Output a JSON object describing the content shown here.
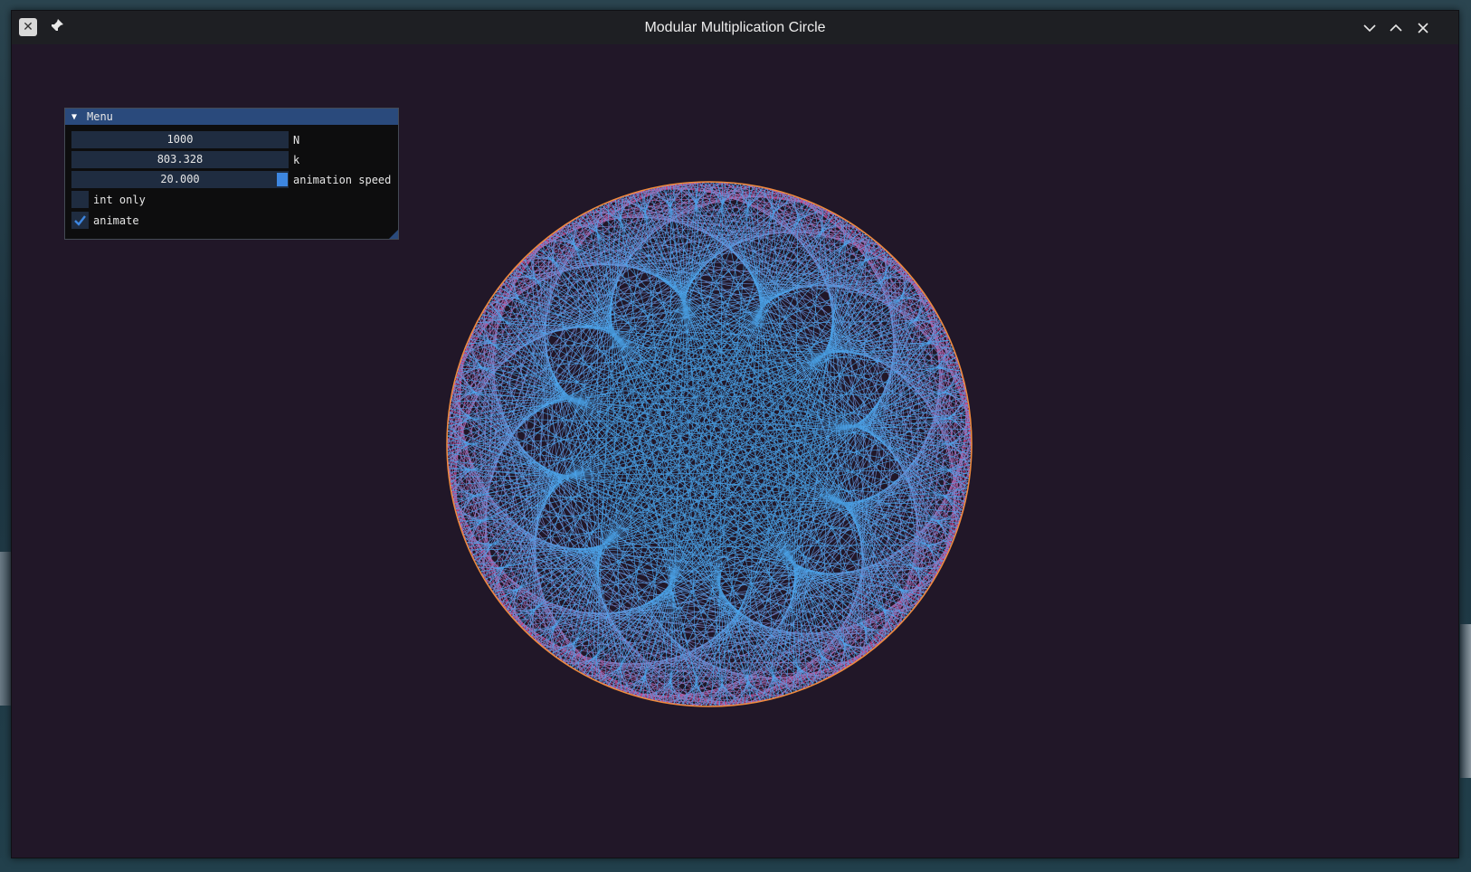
{
  "window": {
    "title": "Modular Multiplication Circle"
  },
  "menu": {
    "title": "Menu",
    "fields": {
      "n_value": "1000",
      "n_label": "N",
      "k_value": "803.328",
      "k_label": "k",
      "speed_value": "20.000",
      "speed_label": "animation speed"
    },
    "int_only": {
      "label": "int only",
      "checked": false
    },
    "animate": {
      "label": "animate",
      "checked": true
    }
  },
  "visualization": {
    "points": 1000,
    "multiplier": 803.328,
    "colors": {
      "background": "#211728",
      "circle": "#f08a3c",
      "line_start": "#4aa8f0",
      "line_end": "#f0337a"
    }
  }
}
